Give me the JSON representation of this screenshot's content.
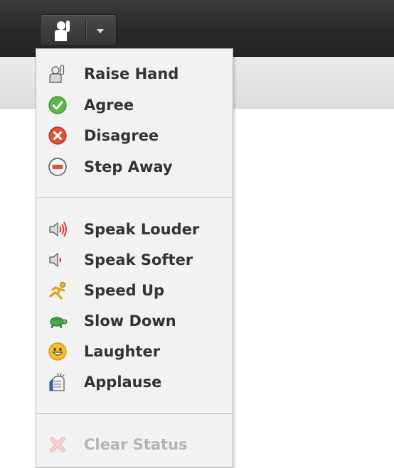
{
  "toolbar": {
    "status_button_icon": "raise-hand-person-icon",
    "dropdown_icon": "caret-down-icon"
  },
  "menu": {
    "groups": [
      [
        {
          "label": "Raise Hand",
          "icon": "raise-hand-icon"
        },
        {
          "label": "Agree",
          "icon": "check-circle-icon",
          "color": "#4caf36"
        },
        {
          "label": "Disagree",
          "icon": "x-circle-icon",
          "color": "#d9402c"
        },
        {
          "label": "Step Away",
          "icon": "minus-circle-icon",
          "color": "#d9402c"
        }
      ],
      [
        {
          "label": "Speak Louder",
          "icon": "speaker-loud-icon",
          "color": "#e2332a"
        },
        {
          "label": "Speak Softer",
          "icon": "speaker-soft-icon",
          "color": "#e2332a"
        },
        {
          "label": "Speed Up",
          "icon": "running-person-icon",
          "color": "#e0a21e"
        },
        {
          "label": "Slow Down",
          "icon": "turtle-icon",
          "color": "#3c9a3c"
        },
        {
          "label": "Laughter",
          "icon": "smiley-icon",
          "color": "#f0b81c"
        },
        {
          "label": "Applause",
          "icon": "clapping-hands-icon",
          "color": "#2a6fb8"
        }
      ]
    ],
    "clear_status": {
      "label": "Clear Status",
      "icon": "clear-x-icon",
      "disabled": true
    }
  }
}
